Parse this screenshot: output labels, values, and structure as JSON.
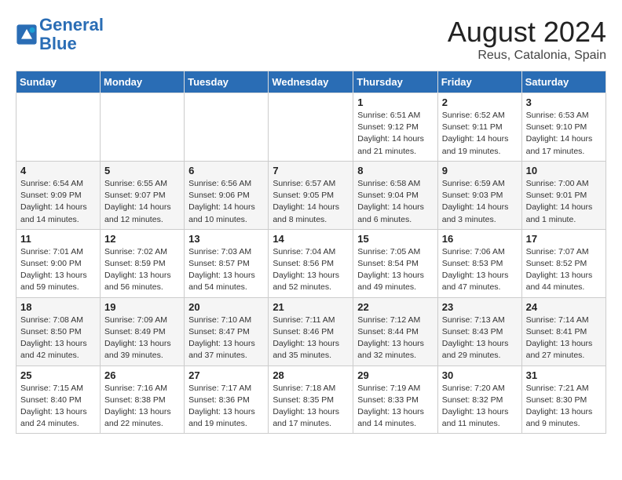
{
  "header": {
    "logo_line1": "General",
    "logo_line2": "Blue",
    "main_title": "August 2024",
    "subtitle": "Reus, Catalonia, Spain"
  },
  "weekdays": [
    "Sunday",
    "Monday",
    "Tuesday",
    "Wednesday",
    "Thursday",
    "Friday",
    "Saturday"
  ],
  "weeks": [
    [
      {
        "day": "",
        "detail": ""
      },
      {
        "day": "",
        "detail": ""
      },
      {
        "day": "",
        "detail": ""
      },
      {
        "day": "",
        "detail": ""
      },
      {
        "day": "1",
        "detail": "Sunrise: 6:51 AM\nSunset: 9:12 PM\nDaylight: 14 hours\nand 21 minutes."
      },
      {
        "day": "2",
        "detail": "Sunrise: 6:52 AM\nSunset: 9:11 PM\nDaylight: 14 hours\nand 19 minutes."
      },
      {
        "day": "3",
        "detail": "Sunrise: 6:53 AM\nSunset: 9:10 PM\nDaylight: 14 hours\nand 17 minutes."
      }
    ],
    [
      {
        "day": "4",
        "detail": "Sunrise: 6:54 AM\nSunset: 9:09 PM\nDaylight: 14 hours\nand 14 minutes."
      },
      {
        "day": "5",
        "detail": "Sunrise: 6:55 AM\nSunset: 9:07 PM\nDaylight: 14 hours\nand 12 minutes."
      },
      {
        "day": "6",
        "detail": "Sunrise: 6:56 AM\nSunset: 9:06 PM\nDaylight: 14 hours\nand 10 minutes."
      },
      {
        "day": "7",
        "detail": "Sunrise: 6:57 AM\nSunset: 9:05 PM\nDaylight: 14 hours\nand 8 minutes."
      },
      {
        "day": "8",
        "detail": "Sunrise: 6:58 AM\nSunset: 9:04 PM\nDaylight: 14 hours\nand 6 minutes."
      },
      {
        "day": "9",
        "detail": "Sunrise: 6:59 AM\nSunset: 9:03 PM\nDaylight: 14 hours\nand 3 minutes."
      },
      {
        "day": "10",
        "detail": "Sunrise: 7:00 AM\nSunset: 9:01 PM\nDaylight: 14 hours\nand 1 minute."
      }
    ],
    [
      {
        "day": "11",
        "detail": "Sunrise: 7:01 AM\nSunset: 9:00 PM\nDaylight: 13 hours\nand 59 minutes."
      },
      {
        "day": "12",
        "detail": "Sunrise: 7:02 AM\nSunset: 8:59 PM\nDaylight: 13 hours\nand 56 minutes."
      },
      {
        "day": "13",
        "detail": "Sunrise: 7:03 AM\nSunset: 8:57 PM\nDaylight: 13 hours\nand 54 minutes."
      },
      {
        "day": "14",
        "detail": "Sunrise: 7:04 AM\nSunset: 8:56 PM\nDaylight: 13 hours\nand 52 minutes."
      },
      {
        "day": "15",
        "detail": "Sunrise: 7:05 AM\nSunset: 8:54 PM\nDaylight: 13 hours\nand 49 minutes."
      },
      {
        "day": "16",
        "detail": "Sunrise: 7:06 AM\nSunset: 8:53 PM\nDaylight: 13 hours\nand 47 minutes."
      },
      {
        "day": "17",
        "detail": "Sunrise: 7:07 AM\nSunset: 8:52 PM\nDaylight: 13 hours\nand 44 minutes."
      }
    ],
    [
      {
        "day": "18",
        "detail": "Sunrise: 7:08 AM\nSunset: 8:50 PM\nDaylight: 13 hours\nand 42 minutes."
      },
      {
        "day": "19",
        "detail": "Sunrise: 7:09 AM\nSunset: 8:49 PM\nDaylight: 13 hours\nand 39 minutes."
      },
      {
        "day": "20",
        "detail": "Sunrise: 7:10 AM\nSunset: 8:47 PM\nDaylight: 13 hours\nand 37 minutes."
      },
      {
        "day": "21",
        "detail": "Sunrise: 7:11 AM\nSunset: 8:46 PM\nDaylight: 13 hours\nand 35 minutes."
      },
      {
        "day": "22",
        "detail": "Sunrise: 7:12 AM\nSunset: 8:44 PM\nDaylight: 13 hours\nand 32 minutes."
      },
      {
        "day": "23",
        "detail": "Sunrise: 7:13 AM\nSunset: 8:43 PM\nDaylight: 13 hours\nand 29 minutes."
      },
      {
        "day": "24",
        "detail": "Sunrise: 7:14 AM\nSunset: 8:41 PM\nDaylight: 13 hours\nand 27 minutes."
      }
    ],
    [
      {
        "day": "25",
        "detail": "Sunrise: 7:15 AM\nSunset: 8:40 PM\nDaylight: 13 hours\nand 24 minutes."
      },
      {
        "day": "26",
        "detail": "Sunrise: 7:16 AM\nSunset: 8:38 PM\nDaylight: 13 hours\nand 22 minutes."
      },
      {
        "day": "27",
        "detail": "Sunrise: 7:17 AM\nSunset: 8:36 PM\nDaylight: 13 hours\nand 19 minutes."
      },
      {
        "day": "28",
        "detail": "Sunrise: 7:18 AM\nSunset: 8:35 PM\nDaylight: 13 hours\nand 17 minutes."
      },
      {
        "day": "29",
        "detail": "Sunrise: 7:19 AM\nSunset: 8:33 PM\nDaylight: 13 hours\nand 14 minutes."
      },
      {
        "day": "30",
        "detail": "Sunrise: 7:20 AM\nSunset: 8:32 PM\nDaylight: 13 hours\nand 11 minutes."
      },
      {
        "day": "31",
        "detail": "Sunrise: 7:21 AM\nSunset: 8:30 PM\nDaylight: 13 hours\nand 9 minutes."
      }
    ]
  ]
}
